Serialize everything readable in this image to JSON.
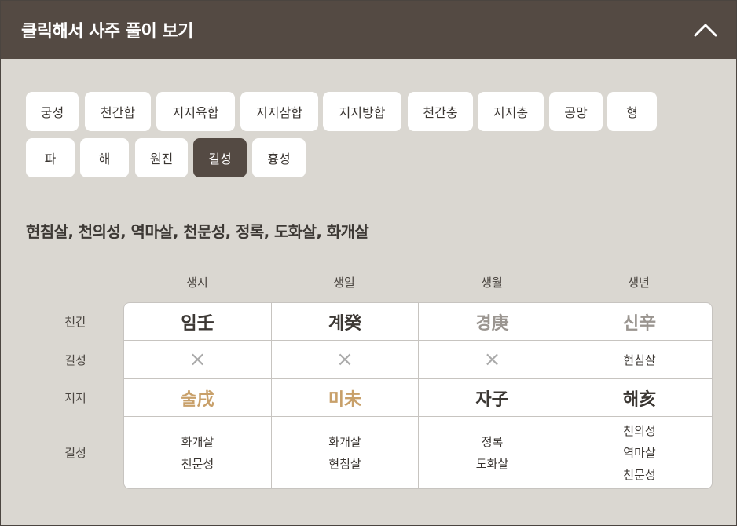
{
  "header": {
    "title": "클릭해서 사주 풀이 보기",
    "toggle_icon": "chevron-up-icon"
  },
  "tabs": [
    {
      "label": "궁성",
      "active": false
    },
    {
      "label": "천간합",
      "active": false
    },
    {
      "label": "지지육합",
      "active": false
    },
    {
      "label": "지지삼합",
      "active": false
    },
    {
      "label": "지지방합",
      "active": false
    },
    {
      "label": "천간충",
      "active": false
    },
    {
      "label": "지지충",
      "active": false
    },
    {
      "label": "공망",
      "active": false
    },
    {
      "label": "형",
      "active": false
    },
    {
      "label": "파",
      "active": false
    },
    {
      "label": "해",
      "active": false
    },
    {
      "label": "원진",
      "active": false
    },
    {
      "label": "길성",
      "active": true
    },
    {
      "label": "흉성",
      "active": false
    }
  ],
  "summary": "현침살, 천의성, 역마살, 천문성, 정록, 도화살, 화개살",
  "columns": [
    "생시",
    "생일",
    "생월",
    "생년"
  ],
  "row_labels": {
    "heavenly": "천간",
    "stars_top": "길성",
    "earthly": "지지",
    "stars_bottom": "길성"
  },
  "heavenly": [
    {
      "text": "임壬",
      "color": "#3c3834"
    },
    {
      "text": "계癸",
      "color": "#3c3834"
    },
    {
      "text": "경庚",
      "color": "#9a9590"
    },
    {
      "text": "신辛",
      "color": "#9a9590"
    }
  ],
  "stars_top": [
    {
      "none": true,
      "mark": "×"
    },
    {
      "none": true,
      "mark": "×"
    },
    {
      "none": true,
      "mark": "×"
    },
    {
      "none": false,
      "text": "현침살"
    }
  ],
  "earthly": [
    {
      "text": "술戌",
      "color": "#c8a06a"
    },
    {
      "text": "미未",
      "color": "#c8a06a"
    },
    {
      "text": "자子",
      "color": "#3c3834"
    },
    {
      "text": "해亥",
      "color": "#3c3834"
    }
  ],
  "stars_bottom": [
    [
      "화개살",
      "천문성"
    ],
    [
      "화개살",
      "현침살"
    ],
    [
      "정록",
      "도화살"
    ],
    [
      "천의성",
      "역마살",
      "천문성"
    ]
  ]
}
